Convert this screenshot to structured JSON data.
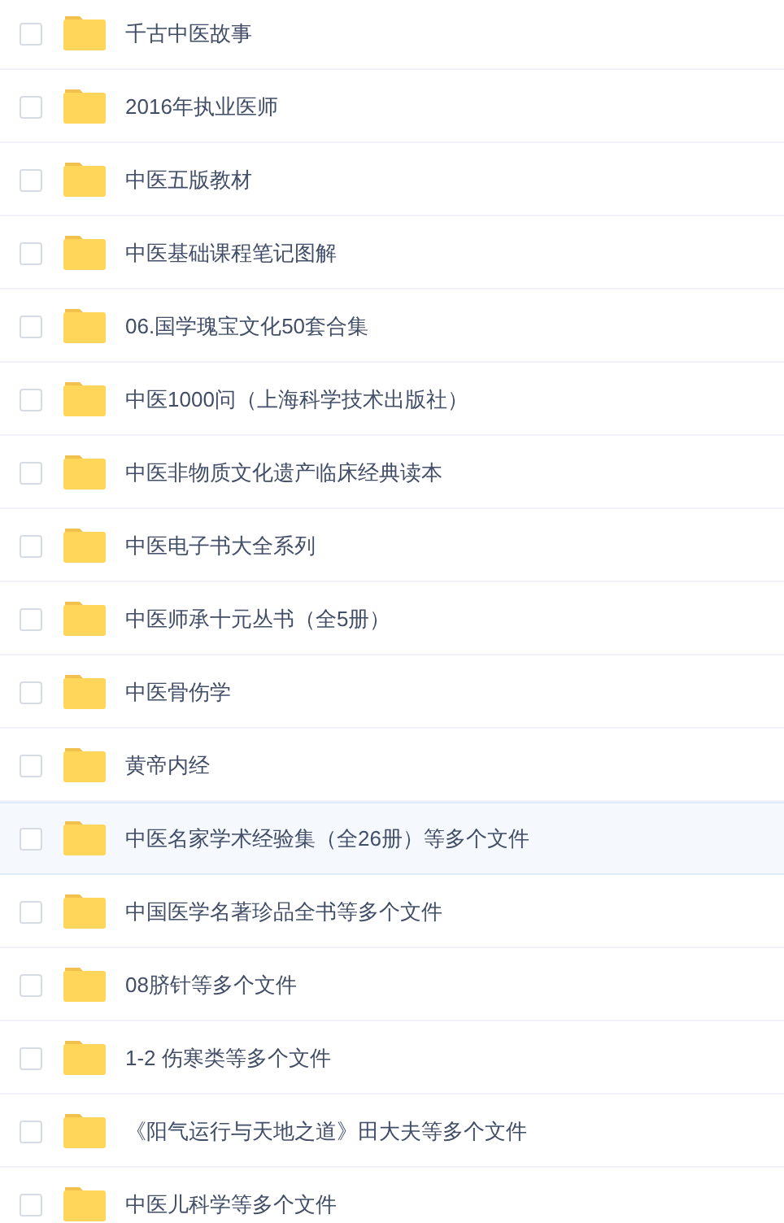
{
  "files": [
    {
      "name": "千古中医故事",
      "checked": false,
      "highlighted": false
    },
    {
      "name": "2016年执业医师",
      "checked": false,
      "highlighted": false
    },
    {
      "name": "中医五版教材",
      "checked": false,
      "highlighted": false
    },
    {
      "name": "中医基础课程笔记图解",
      "checked": false,
      "highlighted": false
    },
    {
      "name": "06.国学瑰宝文化50套合集",
      "checked": false,
      "highlighted": false
    },
    {
      "name": "中医1000问（上海科学技术出版社）",
      "checked": false,
      "highlighted": false
    },
    {
      "name": "中医非物质文化遗产临床经典读本",
      "checked": false,
      "highlighted": false
    },
    {
      "name": "中医电子书大全系列",
      "checked": false,
      "highlighted": false
    },
    {
      "name": "中医师承十元丛书（全5册）",
      "checked": false,
      "highlighted": false
    },
    {
      "name": "中医骨伤学",
      "checked": false,
      "highlighted": false
    },
    {
      "name": "黄帝内经",
      "checked": false,
      "highlighted": false
    },
    {
      "name": "中医名家学术经验集（全26册）等多个文件",
      "checked": false,
      "highlighted": true
    },
    {
      "name": "中国医学名著珍品全书等多个文件",
      "checked": false,
      "highlighted": false
    },
    {
      "name": "08脐针等多个文件",
      "checked": false,
      "highlighted": false
    },
    {
      "name": "1-2 伤寒类等多个文件",
      "checked": false,
      "highlighted": false
    },
    {
      "name": "《阳气运行与天地之道》田大夫等多个文件",
      "checked": false,
      "highlighted": false
    },
    {
      "name": "中医儿科学等多个文件",
      "checked": false,
      "highlighted": false
    }
  ]
}
